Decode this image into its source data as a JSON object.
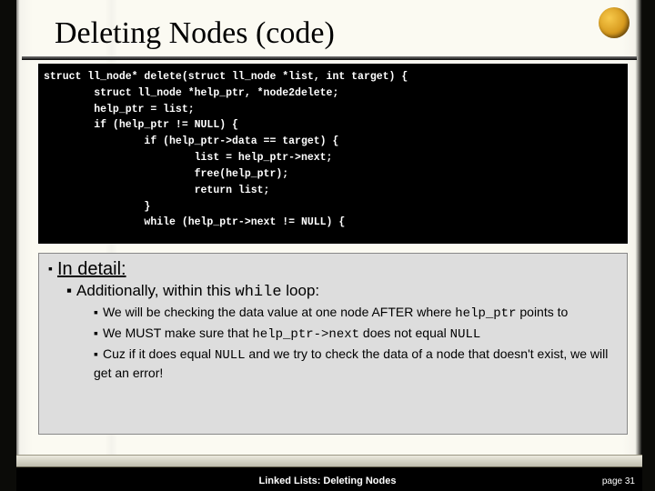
{
  "title": "Deleting Nodes (code)",
  "code": "struct ll_node* delete(struct ll_node *list, int target) {\n        struct ll_node *help_ptr, *node2delete;\n        help_ptr = list;\n        if (help_ptr != NULL) {\n                if (help_ptr->data == target) {\n                        list = help_ptr->next;\n                        free(help_ptr);\n                        return list;\n                }\n                while (help_ptr->next != NULL) {",
  "detail": {
    "heading": "In detail:",
    "line1_pre": "Additionally, within this ",
    "line1_code": "while",
    "line1_post": " loop:",
    "b1_pre": "We will be checking the data value at one node AFTER where ",
    "b1_code": "help_ptr",
    "b1_post": " points to",
    "b2_pre": "We MUST make sure that ",
    "b2_code": "help_ptr->next",
    "b2_mid": " does not equal ",
    "b2_code2": "NULL",
    "b3_pre": "Cuz if it does equal ",
    "b3_code": "NULL",
    "b3_post": " and we try to check the data of a node that doesn't exist, we will get an error!"
  },
  "footer": {
    "center": "Linked Lists:  Deleting Nodes",
    "page": "page 31"
  }
}
